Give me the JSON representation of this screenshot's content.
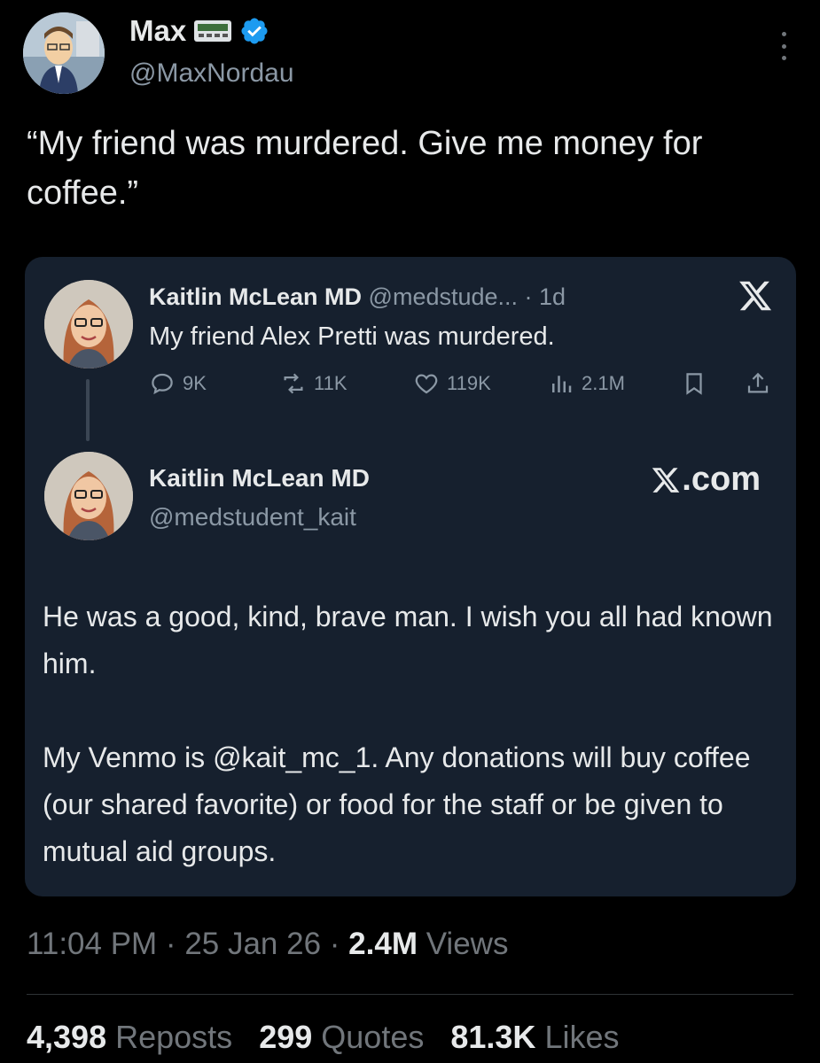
{
  "author": {
    "name": "Max",
    "handle": "@MaxNordau"
  },
  "tweet": {
    "text": "“My friend was murdered. Give me money for coffee.”"
  },
  "quoted": {
    "name": "Kaitlin McLean MD",
    "meta": "@medstude... · 1d",
    "text": "My friend Alex Pretti was murdered.",
    "replies": "9K",
    "reposts": "11K",
    "likes": "119K",
    "views": "2.1M",
    "card": {
      "name": "Kaitlin McLean MD",
      "handle": "@medstudent_kait",
      "site": ".com",
      "paragraph1": "He was a good, kind, brave man. I wish you all had known him.",
      "paragraph2": "My Venmo is @kait_mc_1. Any donations will buy coffee (our shared favorite) or food for the staff or be given to mutual aid groups."
    }
  },
  "timestamp": {
    "time_date": "11:04 PM · 25 Jan 26 · ",
    "views_count": "2.4M",
    "views_label": " Views"
  },
  "stats": {
    "reposts_count": "4,398",
    "reposts_label": "Reposts",
    "quotes_count": "299",
    "quotes_label": "Quotes",
    "likes_count": "81.3K",
    "likes_label": "Likes"
  },
  "colors": {
    "background": "#000000",
    "card": "#16202e",
    "verified": "#1d9bf0",
    "muted": "#71767b"
  }
}
